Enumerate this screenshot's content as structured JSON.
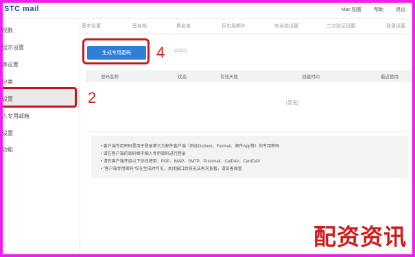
{
  "header": {
    "brand": "STC mail",
    "nav": [
      "Mac 配置",
      "帮助",
      "退出"
    ]
  },
  "sidebar": {
    "items": [
      {
        "label": "规数"
      },
      {
        "label": "显示设置"
      },
      {
        "label": "寄设置"
      },
      {
        "label": "分类"
      },
      {
        "label": "设置"
      },
      {
        "label": "人专用邮箱"
      },
      {
        "label": "设置"
      },
      {
        "label": "功能"
      }
    ],
    "active_index": 4
  },
  "tabs": [
    "基本设置",
    "签名档",
    "黑名单",
    "反垃圾邮件",
    "安全锁设置",
    "二次验证设置",
    "登录设置"
  ],
  "main": {
    "generate_button": "生成专用密码",
    "button_note": "(0/20)",
    "table_headers": [
      "密码名称",
      "状态",
      "有效天数",
      "创建时间",
      "最近使用"
    ],
    "empty_text": "(暂无)",
    "info_lines": [
      "• 客户端专用密码是用于登录第三方邮件客户端（例如Outlook、Foxmail、邮件App等）的专用密码",
      "• 请在客户端的密码框中输入专用密码进行登录",
      "• 请在客户端开启以下协议使用：POP、IMAP、SMTP、Pushmail、CalDAV、CardDAV",
      "• “客户端专用密码”仅在生成时可见，关闭窗口后将无法再次查看，请妥善保管"
    ]
  },
  "annotations": {
    "step_sidebar": "2",
    "step_button": "4"
  },
  "watermark": "配资资讯",
  "colors": {
    "frame": "#f21df0",
    "highlight": "#c6151b",
    "button": "#2f7fd8"
  }
}
